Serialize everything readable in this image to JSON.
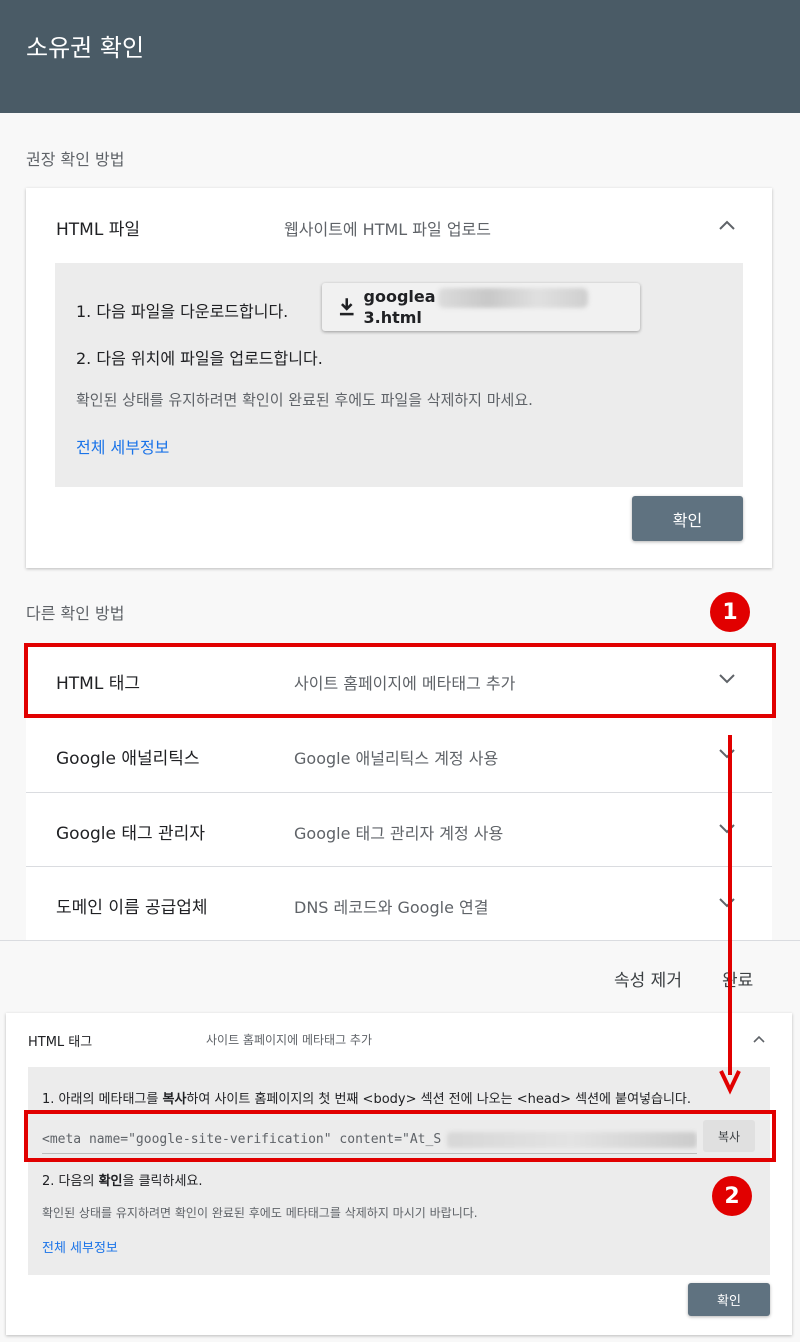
{
  "header": {
    "title": "소유권 확인"
  },
  "recommended": {
    "section_label": "권장 확인 방법",
    "card": {
      "title": "HTML 파일",
      "description": "웹사이트에 HTML 파일 업로드",
      "step1": "1. 다음 파일을 다운로드합니다.",
      "download_prefix": "googlea",
      "download_suffix": "3.html",
      "step2": "2. 다음 위치에 파일을 업로드합니다.",
      "note": "확인된 상태를 유지하려면 확인이 완료된 후에도 파일을 삭제하지 마세요.",
      "details_link": "전체 세부정보",
      "confirm_label": "확인"
    }
  },
  "other": {
    "section_label": "다른 확인 방법",
    "methods": [
      {
        "title": "HTML 태그",
        "description": "사이트 홈페이지에 메타태그 추가"
      },
      {
        "title": "Google 애널리틱스",
        "description": "Google 애널리틱스 계정 사용"
      },
      {
        "title": "Google 태그 관리자",
        "description": "Google 태그 관리자 계정 사용"
      },
      {
        "title": "도메인 이름 공급업체",
        "description": "DNS 레코드와 Google 연결"
      }
    ]
  },
  "footer": {
    "remove_property": "속성 제거",
    "done": "완료"
  },
  "expanded": {
    "title": "HTML 태그",
    "description": "사이트 홈페이지에 메타태그 추가",
    "step1_pre": "1. 아래의 메타태그를 ",
    "step1_bold": "복사",
    "step1_post": "하여 사이트 홈페이지의 첫 번째 <body> 섹션 전에 나오는 <head> 섹션에 붙여넣습니다.",
    "meta_text": "<meta name=\"google-site-verification\" content=\"At_S",
    "copy_label": "복사",
    "step2_pre": "2. 다음의 ",
    "step2_bold": "확인",
    "step2_post": "을 클릭하세요.",
    "note": "확인된 상태를 유지하려면 확인이 완료된 후에도 메타태그를 삭제하지 마시기 바랍니다.",
    "details_link": "전체 세부정보",
    "confirm_label": "확인"
  },
  "annotations": {
    "badge1": "1",
    "badge2": "2",
    "accent_color": "#e10000"
  }
}
